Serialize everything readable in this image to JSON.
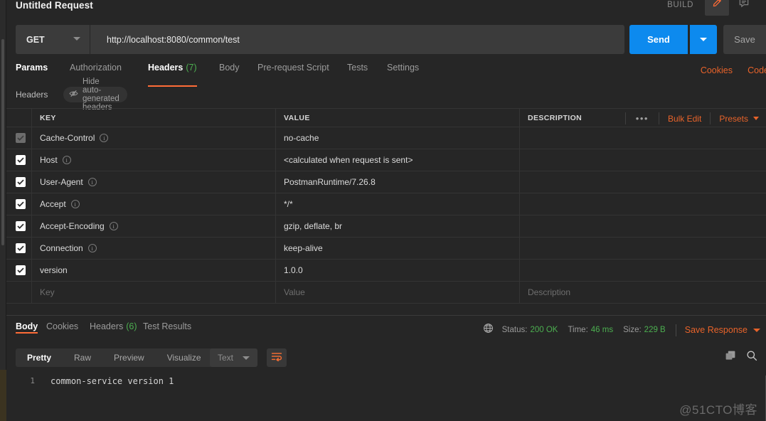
{
  "window": {
    "request_title": "Untitled Request",
    "build_label": "BUILD",
    "edit_icon": "pencil-icon",
    "comment_icon": "comment-icon"
  },
  "url_bar": {
    "method": "GET",
    "url": "http://localhost:8080/common/test",
    "send_label": "Send",
    "save_label": "Save"
  },
  "request_tabs": {
    "items": [
      {
        "label": "Params",
        "count": "",
        "selected": false
      },
      {
        "label": "Authorization",
        "count": "",
        "selected": false
      },
      {
        "label": "Headers",
        "count": "(7)",
        "selected": true
      },
      {
        "label": "Body",
        "count": "",
        "selected": false
      },
      {
        "label": "Pre-request Script",
        "count": "",
        "selected": false
      },
      {
        "label": "Tests",
        "count": "",
        "selected": false
      },
      {
        "label": "Settings",
        "count": "",
        "selected": false
      }
    ],
    "cookies_link": "Cookies",
    "code_link": "Code"
  },
  "headers_toolbar": {
    "title": "Headers",
    "hide_auto_generated": "Hide auto-generated headers",
    "eye_slash_icon": "eye-slash-icon"
  },
  "headers_table": {
    "columns": [
      "KEY",
      "VALUE",
      "DESCRIPTION"
    ],
    "tools": {
      "more_label": "•••",
      "bulk_edit": "Bulk Edit",
      "presets": "Presets"
    },
    "rows": [
      {
        "checked": true,
        "muted": true,
        "key": "Cache-Control",
        "info": true,
        "value": "no-cache",
        "description": ""
      },
      {
        "checked": true,
        "muted": false,
        "key": "Host",
        "info": true,
        "value": "<calculated when request is sent>",
        "description": ""
      },
      {
        "checked": true,
        "muted": false,
        "key": "User-Agent",
        "info": true,
        "value": "PostmanRuntime/7.26.8",
        "description": ""
      },
      {
        "checked": true,
        "muted": false,
        "key": "Accept",
        "info": true,
        "value": "*/*",
        "description": ""
      },
      {
        "checked": true,
        "muted": false,
        "key": "Accept-Encoding",
        "info": true,
        "value": "gzip, deflate, br",
        "description": ""
      },
      {
        "checked": true,
        "muted": false,
        "key": "Connection",
        "info": true,
        "value": "keep-alive",
        "description": ""
      },
      {
        "checked": true,
        "muted": false,
        "key": "version",
        "info": false,
        "value": "1.0.0",
        "description": ""
      }
    ],
    "new_row": {
      "key_placeholder": "Key",
      "value_placeholder": "Value",
      "description_placeholder": "Description"
    }
  },
  "response": {
    "tabs": [
      {
        "label": "Body",
        "count": "",
        "selected": true
      },
      {
        "label": "Cookies",
        "count": "",
        "selected": false
      },
      {
        "label": "Headers",
        "count": "(6)",
        "selected": false
      },
      {
        "label": "Test Results",
        "count": "",
        "selected": false
      }
    ],
    "globe_icon": "globe-icon",
    "status_label": "Status:",
    "status_value": "200 OK",
    "time_label": "Time:",
    "time_value": "46 ms",
    "size_label": "Size:",
    "size_value": "229 B",
    "save_response": "Save Response",
    "viewer_tabs": [
      {
        "label": "Pretty",
        "selected": true
      },
      {
        "label": "Raw",
        "selected": false
      },
      {
        "label": "Preview",
        "selected": false
      },
      {
        "label": "Visualize",
        "selected": false
      }
    ],
    "format": "Text",
    "wrap_icon": "word-wrap-icon",
    "copy_icon": "copy-icon",
    "search_icon": "search-icon",
    "body_lines": [
      {
        "number": "1",
        "text": "common-service version 1"
      }
    ]
  },
  "watermark": "@51CTO博客",
  "colors": {
    "accent": "#ff6c37",
    "link": "#e8632a",
    "send_blue": "#0d8aee",
    "success_green": "#4caf50",
    "panel_bg": "#262626",
    "field_bg": "#3b3b3b"
  }
}
